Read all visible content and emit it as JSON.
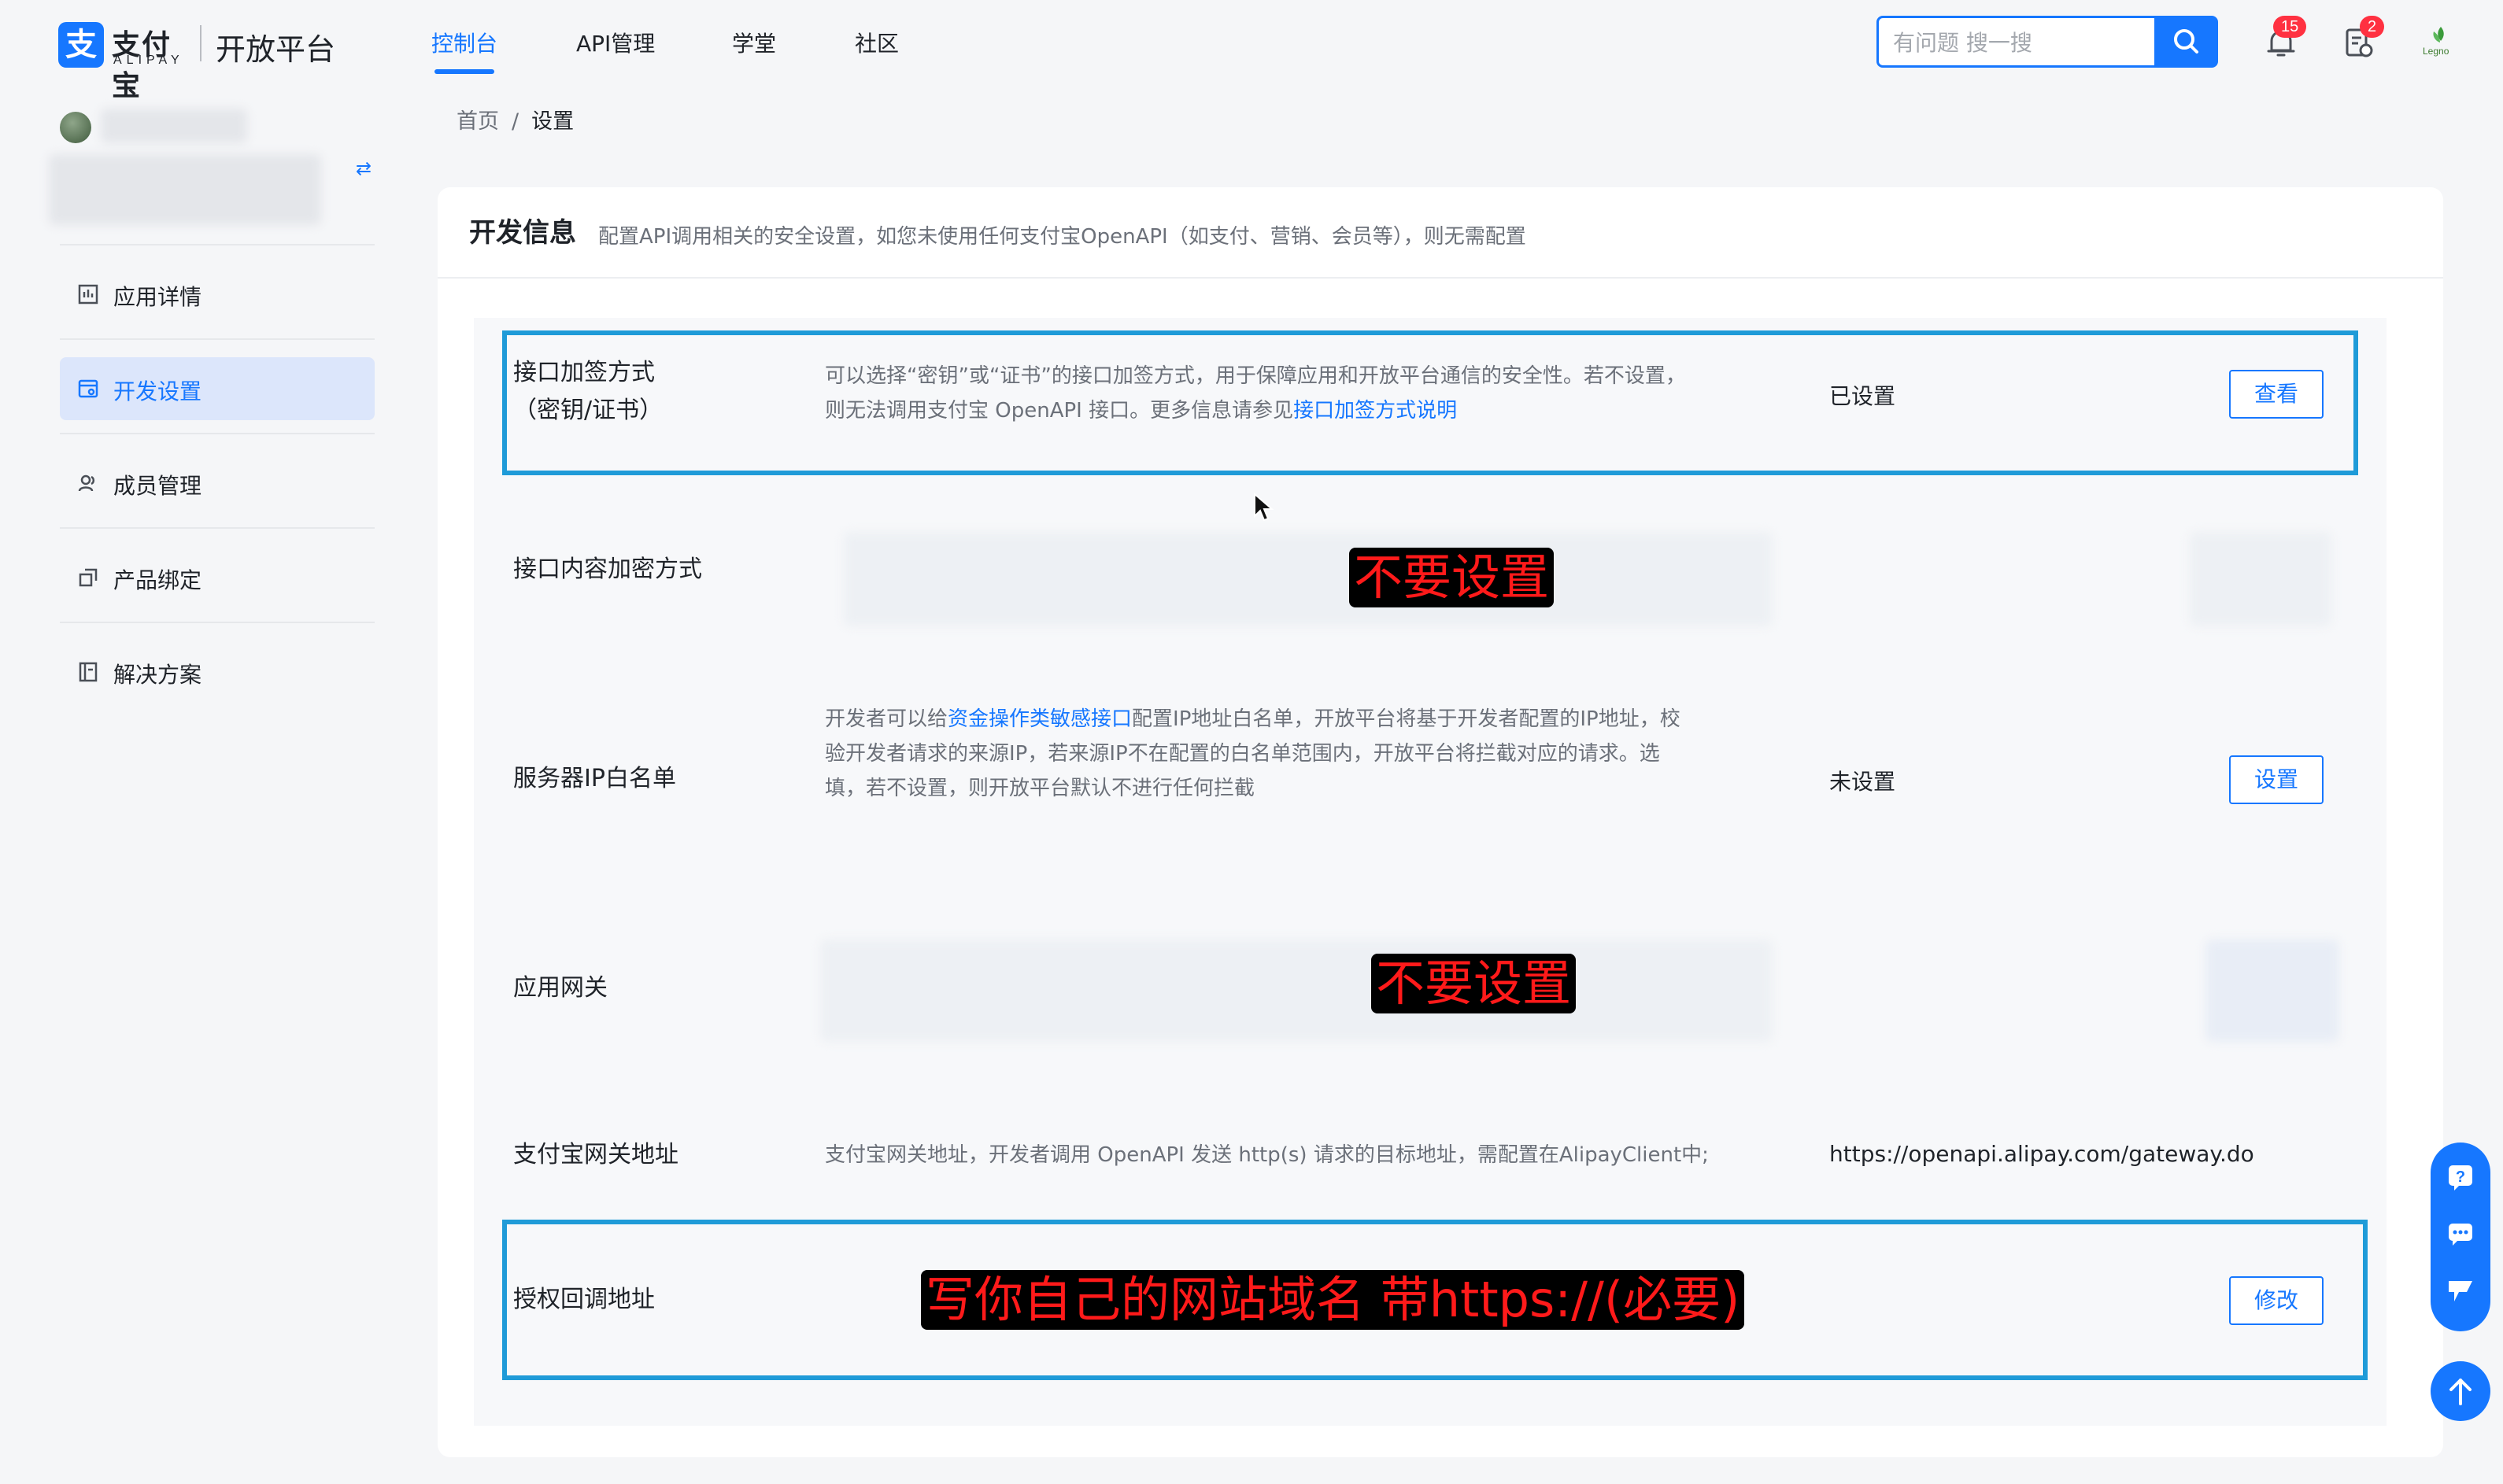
{
  "header": {
    "logo_mark": "支",
    "logo_cn": "支付宝",
    "logo_en": "ALIPAY",
    "platform_name": "开放平台",
    "nav": [
      {
        "label": "控制台",
        "active": true
      },
      {
        "label": "API管理",
        "active": false
      },
      {
        "label": "学堂",
        "active": false
      },
      {
        "label": "社区",
        "active": false
      }
    ],
    "search_placeholder": "有问题 搜一搜",
    "notifications_badge": "15",
    "tasks_badge": "2",
    "avatar_text": "Legno"
  },
  "sidebar": {
    "items": [
      {
        "label": "应用详情",
        "icon": "chart-icon",
        "active": false
      },
      {
        "label": "开发设置",
        "icon": "settings-card-icon",
        "active": true
      },
      {
        "label": "成员管理",
        "icon": "members-icon",
        "active": false
      },
      {
        "label": "产品绑定",
        "icon": "product-bind-icon",
        "active": false
      },
      {
        "label": "解决方案",
        "icon": "solution-icon",
        "active": false
      }
    ]
  },
  "breadcrumb": {
    "home": "首页",
    "separator": "/",
    "current": "设置"
  },
  "card": {
    "title": "开发信息",
    "desc": "配置API调用相关的安全设置，如您未使用任何支付宝OpenAPI（如支付、营销、会员等），则无需配置"
  },
  "rows": [
    {
      "name_line1": "接口加签方式",
      "name_line2": "（密钥/证书）",
      "desc_line1": "可以选择“密钥”或“证书”的接口加签方式，用于保障应用和开放平台通信的安全性。若不设置，",
      "desc_line2_prefix": "则无法调用支付宝 OpenAPI 接口。更多信息请参见",
      "desc_link": "接口加签方式说明",
      "status": "已设置",
      "button": "查看"
    },
    {
      "name": "接口内容加密方式",
      "annotation": "不要设置"
    },
    {
      "name": "服务器IP白名单",
      "desc_prefix": "开发者可以给",
      "desc_link": "资金操作类敏感接口",
      "desc_line1_suffix": "配置IP地址白名单，开放平台将基于开发者配置的IP地址，校",
      "desc_line2": "验开发者请求的来源IP，若来源IP不在配置的白名单范围内，开放平台将拦截对应的请求。选",
      "desc_line3": "填，若不设置，则开放平台默认不进行任何拦截",
      "status": "未设置",
      "button": "设置"
    },
    {
      "name": "应用网关",
      "annotation": "不要设置"
    },
    {
      "name": "支付宝网关地址",
      "desc": "支付宝网关地址，开发者调用 OpenAPI 发送 http(s) 请求的目标地址，需配置在AlipayClient中;",
      "value": "https://openapi.alipay.com/gateway.do"
    },
    {
      "name": "授权回调地址",
      "annotation": "写你自己的网站域名 带https://(必要)",
      "button": "修改"
    }
  ],
  "colors": {
    "accent": "#1677ff",
    "highlight_border": "#1f9bd8",
    "annotation_text": "#ff1a1a",
    "badge": "#ff3141"
  }
}
